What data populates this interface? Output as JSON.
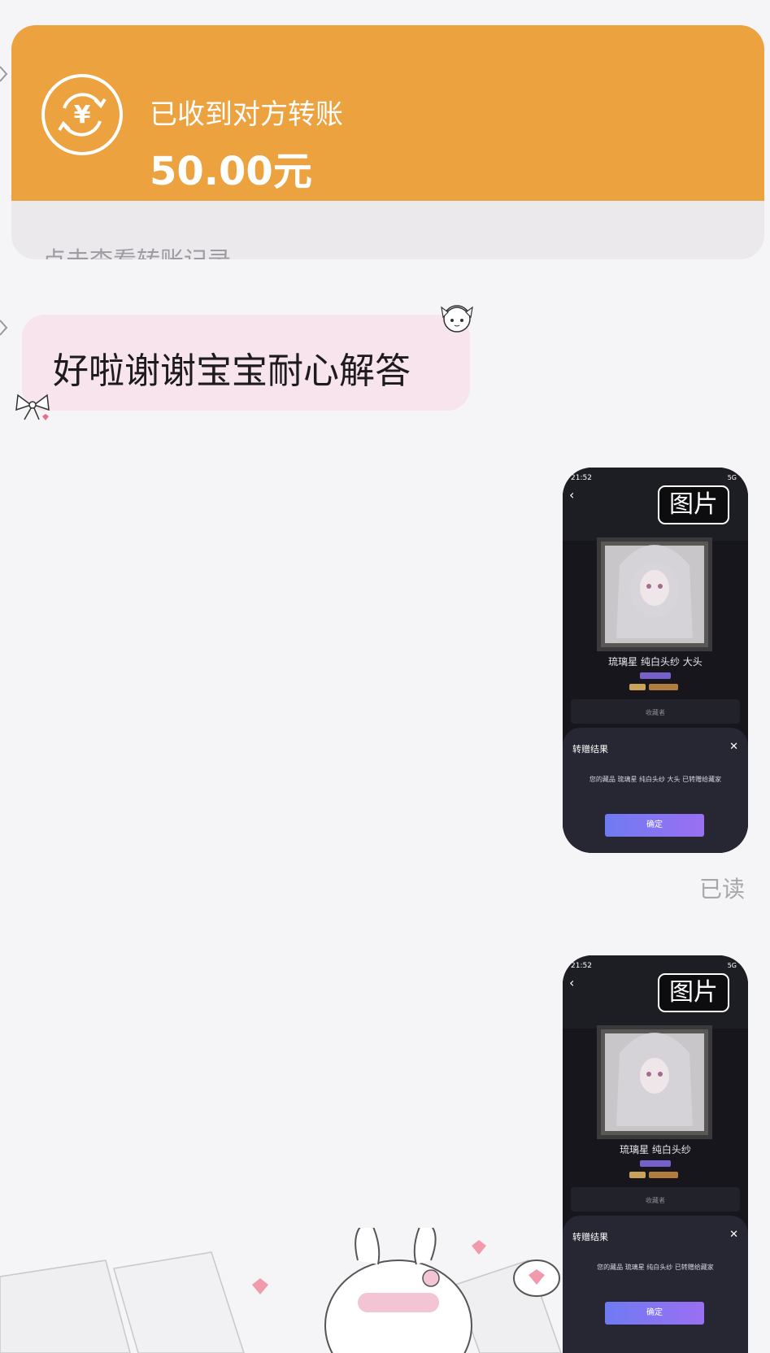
{
  "transfer": {
    "status": "已收到对方转账",
    "amount": "50.00元",
    "link": "点击查看转账记录",
    "icon": "yuan-exchange-icon",
    "accent_color": "#eca23e"
  },
  "messages": {
    "received_text": "好啦谢谢宝宝耐心解答",
    "bubble_color": "#f7e4ec"
  },
  "image_messages": [
    {
      "badge": "图片",
      "status_time": "21:52",
      "status_net": "5G",
      "artwork_title": "琉璃星 纯白头纱 大头",
      "collector_label": "收藏者",
      "dialog_title": "转赠结果",
      "dialog_body": "您的藏品 琉璃星 纯白头纱 大头 已转赠给藏家",
      "dialog_button": "确定"
    },
    {
      "badge": "图片",
      "status_time": "21:52",
      "status_net": "5G",
      "artwork_title": "琉璃星 纯白头纱",
      "collector_label": "收藏者",
      "dialog_title": "转赠结果",
      "dialog_body": "您的藏品 琉璃星 纯白头纱 已转赠给藏家",
      "dialog_button": "确定"
    }
  ],
  "read_receipt": "已读"
}
